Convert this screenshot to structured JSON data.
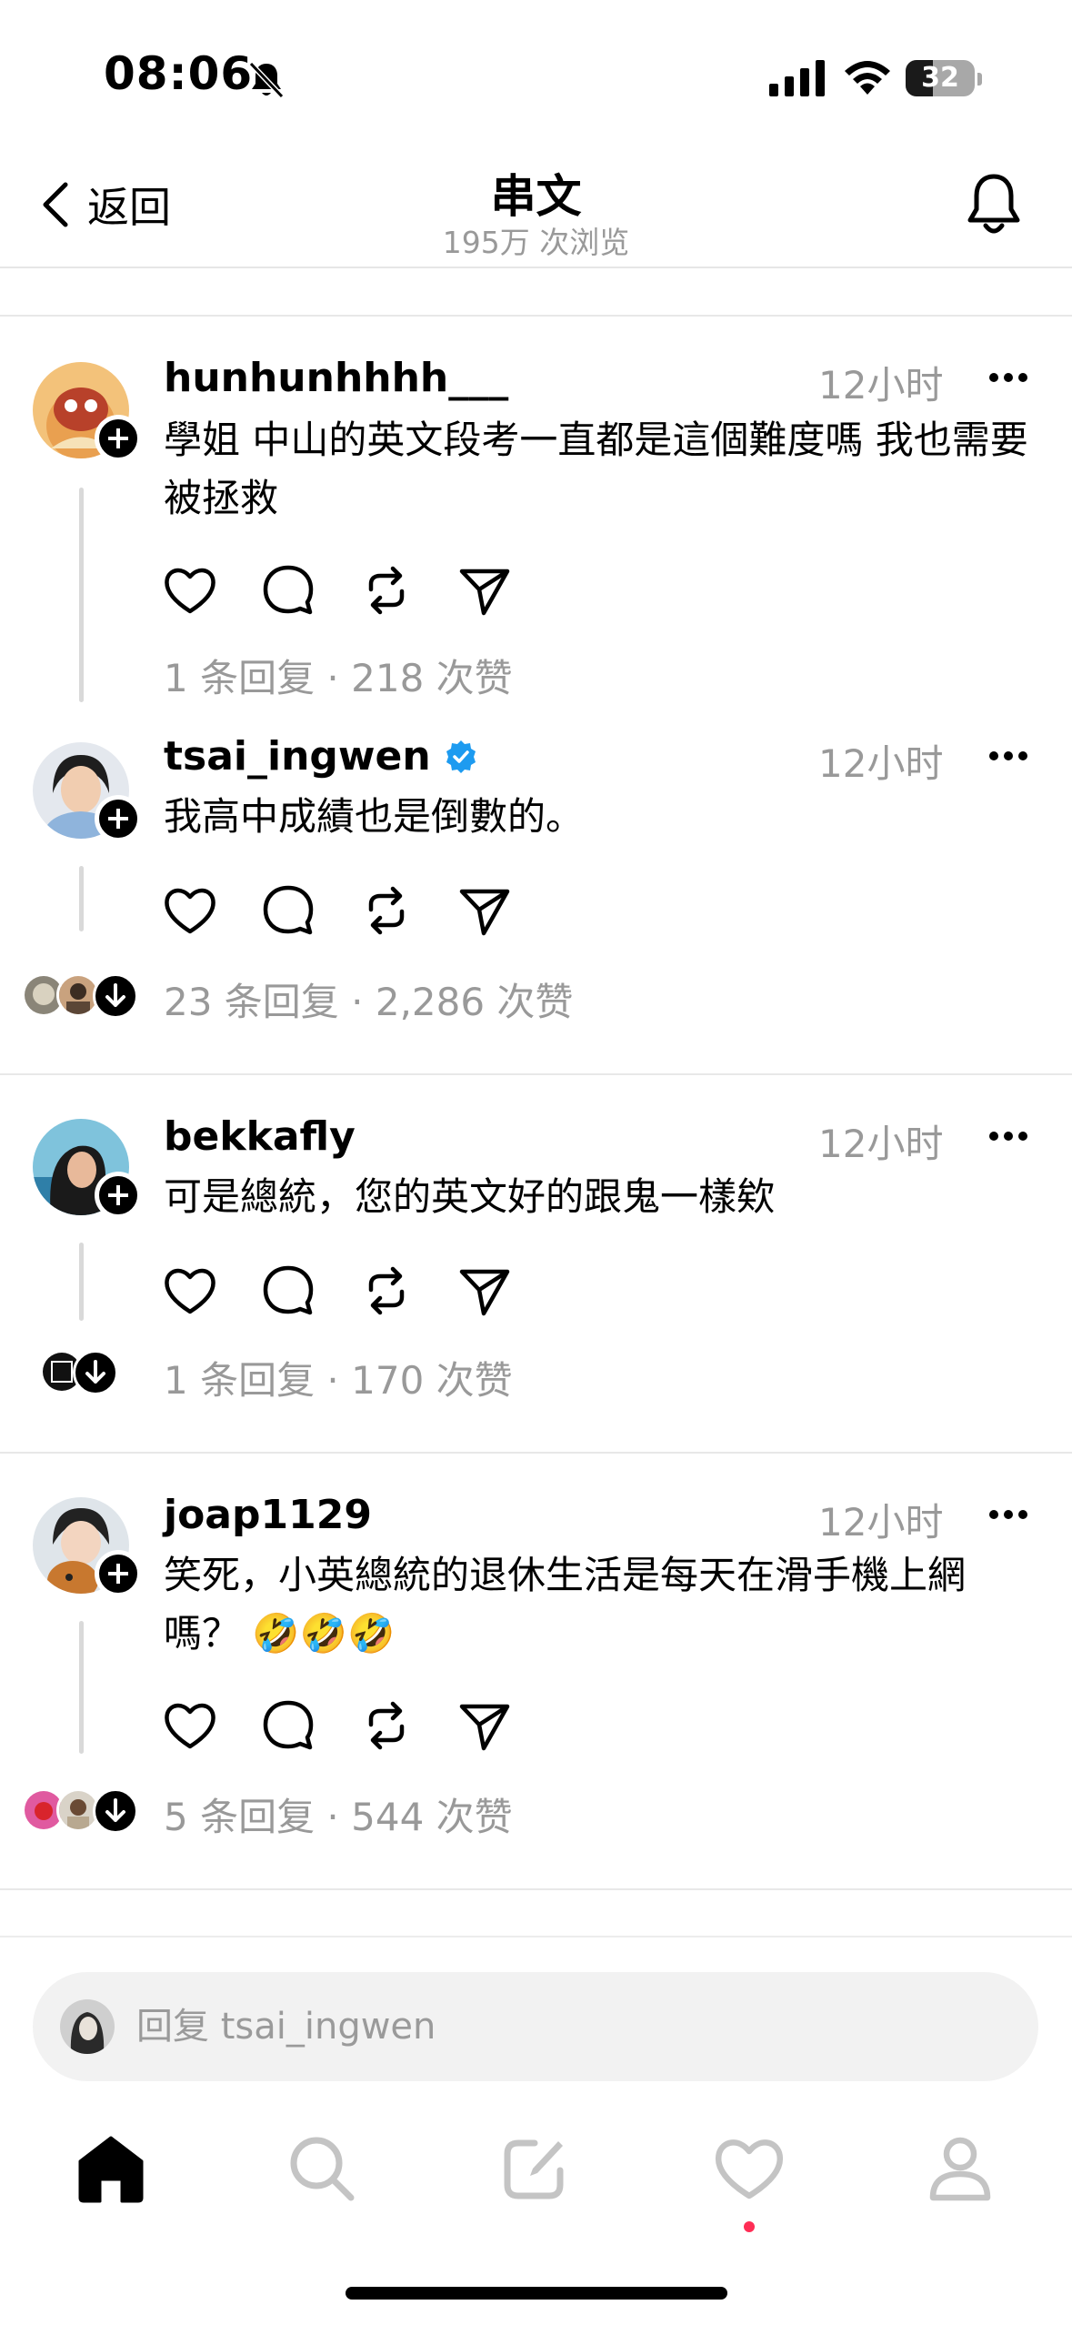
{
  "status_bar": {
    "time": "08:06",
    "battery": "32"
  },
  "header": {
    "back_label": "返回",
    "title": "串文",
    "subtitle": "195万 次浏览"
  },
  "threads": [
    {
      "username": "hunhunhhhh___",
      "verified": false,
      "time": "12小时",
      "text": "學姐 中山的英文段考一直都是這個難度嗎 我也需要被拯救",
      "stats": "1 条回复 · 218 次赞"
    },
    {
      "username": "tsai_ingwen",
      "verified": true,
      "time": "12小时",
      "text": "我高中成績也是倒數的。",
      "stats": "23 条回复 · 2,286 次赞"
    },
    {
      "username": "bekkafly",
      "verified": false,
      "time": "12小时",
      "text": "可是總統，您的英文好的跟鬼一樣欸",
      "stats": "1 条回复 · 170 次赞"
    },
    {
      "username": "joap1129",
      "verified": false,
      "time": "12小时",
      "text": "笑死，小英總統的退休生活是每天在滑手機上網嗎？ 🤣🤣🤣",
      "stats": "5 条回复 · 544 次赞"
    }
  ],
  "reply_bar": {
    "placeholder": "回复 tsai_ingwen"
  },
  "tabbar": {
    "icons": [
      "home-icon",
      "search-icon",
      "compose-icon",
      "heart-icon",
      "profile-icon"
    ]
  },
  "colors": {
    "verified": "#1d9bf0",
    "muted_text": "#999999",
    "notification_dot": "#ff2d55"
  }
}
